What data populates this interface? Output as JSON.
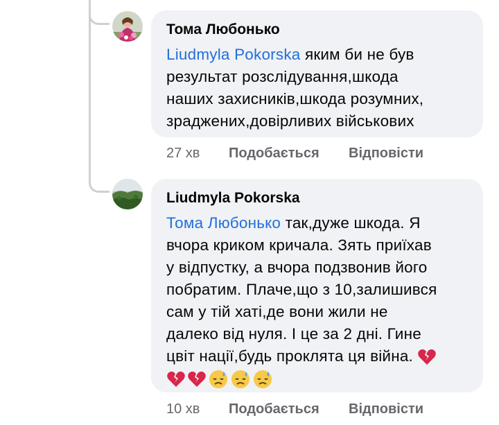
{
  "comments": [
    {
      "author": "Тома Любонько",
      "mention": "Liudmyla Pokorska",
      "lines": [
        " яким би не був",
        "результат розслідування,шкода",
        "наших захисників,шкода розумних,",
        "зраджених,довірливих військових"
      ],
      "time": "27 хв",
      "like_label": "Подобається",
      "reply_label": "Відповісти",
      "avatar_icon": "profile-photo-woman-flowers"
    },
    {
      "author": "Liudmyla Pokorska",
      "mention": "Тома Любонько",
      "lines": [
        " так,дуже шкода. Я",
        "вчора криком кричала. Зять приїхав",
        "у відпустку, а вчора подзвонив його",
        "побратим. Плаче,що з 10,залишився",
        "сам у тій хаті,де вони жили не",
        "далеко від нуля. І це за 2 дні. Гине",
        "цвіт нації,будь проклята ця війна."
      ],
      "emojis": [
        "broken-heart-icon",
        "broken-heart-icon",
        "broken-heart-icon",
        "sad-sweat-face-icon",
        "sad-sweat-face-icon",
        "sad-sweat-face-icon"
      ],
      "time": "10 хв",
      "like_label": "Подобається",
      "reply_label": "Відповісти",
      "avatar_icon": "profile-photo-landscape"
    }
  ],
  "colors": {
    "mention": "#216fdb",
    "bubble": "#f0f2f5",
    "meta": "#65676b",
    "thread_line": "#ced0d4"
  }
}
